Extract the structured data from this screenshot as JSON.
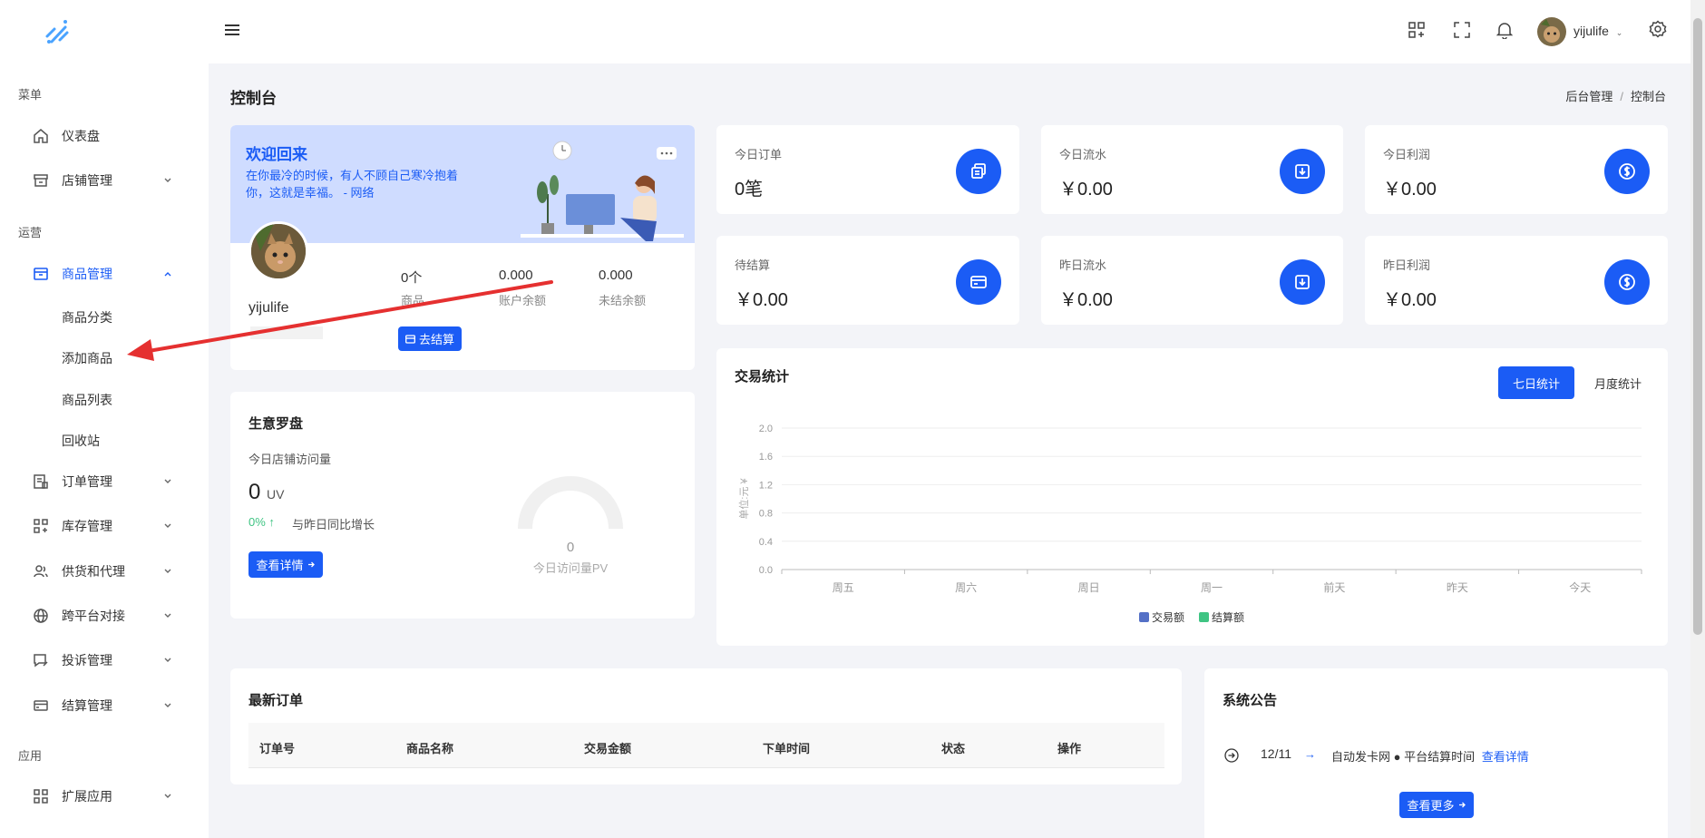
{
  "sidebar": {
    "sections": {
      "menu": "菜单",
      "ops": "运营",
      "apps": "应用"
    },
    "items": [
      {
        "label": "仪表盘"
      },
      {
        "label": "店铺管理"
      },
      {
        "label": "商品管理"
      },
      {
        "label": "订单管理"
      },
      {
        "label": "库存管理"
      },
      {
        "label": "供货和代理"
      },
      {
        "label": "跨平台对接"
      },
      {
        "label": "投诉管理"
      },
      {
        "label": "结算管理"
      },
      {
        "label": "扩展应用"
      }
    ],
    "sub_items": [
      "商品分类",
      "添加商品",
      "商品列表",
      "回收站"
    ]
  },
  "topbar": {
    "username": "yijulife"
  },
  "page": {
    "title": "控制台",
    "breadcrumb": [
      "后台管理",
      "控制台"
    ]
  },
  "welcome": {
    "title": "欢迎回来",
    "quote": "在你最冷的时候，有人不顾自己寒冷抱着你，这就是幸福。 - 网络",
    "username": "yijulife",
    "stats": [
      {
        "value": "0个",
        "label": "商品"
      },
      {
        "value": "0.000",
        "label": "账户余额"
      },
      {
        "value": "0.000",
        "label": "未结余额"
      }
    ],
    "settle_button": "去结算"
  },
  "stat_cards": [
    {
      "label": "今日订单",
      "value": "0笔",
      "icon": "copy-icon"
    },
    {
      "label": "今日流水",
      "value": "￥0.00",
      "icon": "download-box-icon"
    },
    {
      "label": "今日利润",
      "value": "￥0.00",
      "icon": "dollar-icon"
    },
    {
      "label": "待结算",
      "value": "￥0.00",
      "icon": "card-icon"
    },
    {
      "label": "昨日流水",
      "value": "￥0.00",
      "icon": "download-box-icon"
    },
    {
      "label": "昨日利润",
      "value": "￥0.00",
      "icon": "dollar-icon"
    }
  ],
  "compass": {
    "title": "生意罗盘",
    "subtitle": "今日店铺访问量",
    "uv_value": "0",
    "uv_unit": "UV",
    "growth": "0% ↑",
    "growth_label": "与昨日同比增长",
    "details_button": "查看详情",
    "gauge_value": "0",
    "gauge_label": "今日访问量PV",
    "gauge_fraction": 0
  },
  "trade": {
    "title": "交易统计",
    "tabs": [
      "七日统计",
      "月度统计"
    ],
    "active_tab": 0
  },
  "chart_data": {
    "type": "bar",
    "categories": [
      "周五",
      "周六",
      "周日",
      "周一",
      "前天",
      "昨天",
      "今天"
    ],
    "series": [
      {
        "name": "交易额",
        "values": [
          0,
          0,
          0,
          0,
          0,
          0,
          0
        ],
        "color": "#5470c6"
      },
      {
        "name": "结算额",
        "values": [
          0,
          0,
          0,
          0,
          0,
          0,
          0
        ],
        "color": "#3fc483"
      }
    ],
    "ylabel": "单位:元 ¥",
    "ylim": [
      0,
      2.0
    ],
    "yticks": [
      "0.0",
      "0.4",
      "0.8",
      "1.2",
      "1.6",
      "2.0"
    ],
    "grid": true,
    "legend": "bottom-center"
  },
  "orders": {
    "title": "最新订单",
    "columns": [
      "订单号",
      "商品名称",
      "交易金额",
      "下单时间",
      "状态",
      "操作"
    ],
    "rows": []
  },
  "notice": {
    "title": "系统公告",
    "items": [
      {
        "date": "12/11",
        "text": "自动发卡网 ● 平台结算时间",
        "link": "查看详情"
      }
    ],
    "more_button": "查看更多"
  },
  "colors": {
    "primary": "#1b5cf5",
    "banner": "#cfdcff",
    "growth": "#3fc483"
  }
}
